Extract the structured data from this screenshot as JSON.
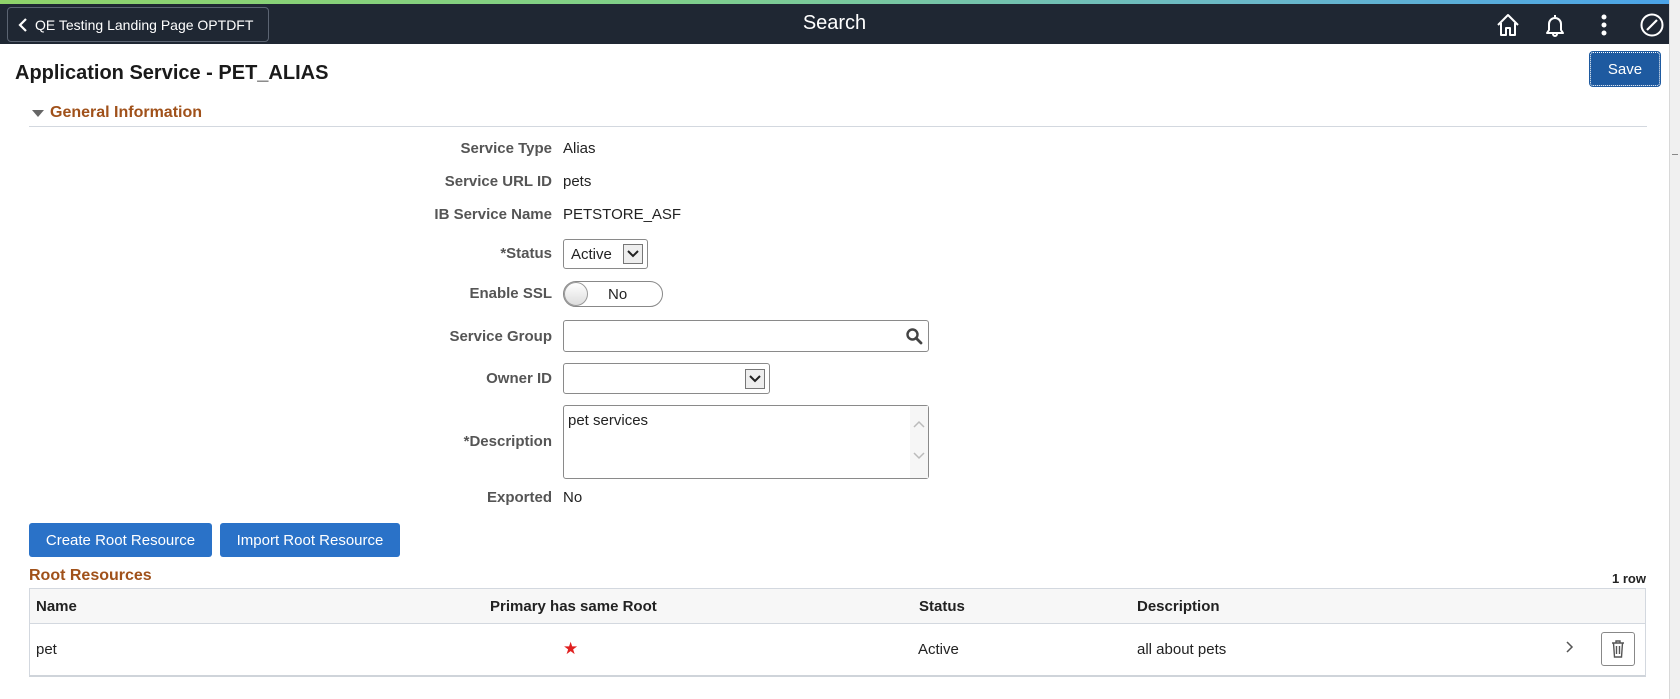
{
  "header": {
    "back_label": "QE Testing Landing Page OPTDFT",
    "title": "Search",
    "icons": [
      "home-icon",
      "bell-icon",
      "more-vertical-icon",
      "compass-icon"
    ]
  },
  "page": {
    "title": "Application Service - PET_ALIAS",
    "save_label": "Save"
  },
  "general_info": {
    "section_title": "General Information",
    "service_type_label": "Service Type",
    "service_type": "Alias",
    "service_url_id_label": "Service URL ID",
    "service_url_id": "pets",
    "ib_service_name_label": "IB Service Name",
    "ib_service_name": "PETSTORE_ASF",
    "status_label": "*Status",
    "status_value": "Active",
    "enable_ssl_label": "Enable SSL",
    "enable_ssl_value": "No",
    "service_group_label": "Service Group",
    "service_group_value": "",
    "owner_id_label": "Owner ID",
    "owner_id_value": "",
    "description_label": "*Description",
    "description_value": "pet services",
    "exported_label": "Exported",
    "exported_value": "No"
  },
  "actions": {
    "create_root_label": "Create Root Resource",
    "import_root_label": "Import Root Resource"
  },
  "root_resources": {
    "title": "Root Resources",
    "row_count": "1 row",
    "columns": [
      "Name",
      "Primary has same Root",
      "Status",
      "Description"
    ],
    "rows": [
      {
        "name": "pet",
        "primary_same_root": "★",
        "status": "Active",
        "description": "all about pets"
      }
    ]
  }
}
